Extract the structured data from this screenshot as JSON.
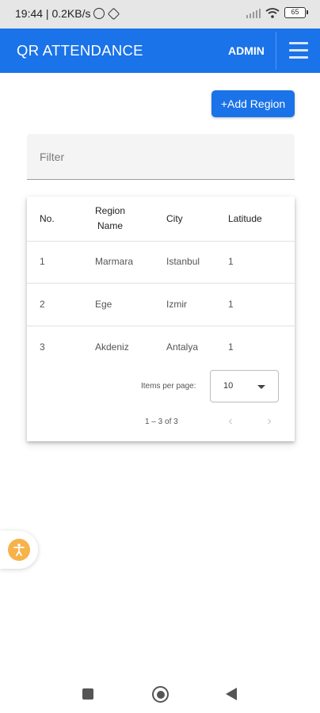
{
  "status_bar": {
    "time_speed": "19:44 | 0.2KB/s",
    "battery": "65"
  },
  "app_bar": {
    "title": "QR ATTENDANCE",
    "admin_label": "ADMIN",
    "menu_icon": "hamburger-menu-icon",
    "color": "#1a73e8"
  },
  "add_button": {
    "label": "+Add Region"
  },
  "filter": {
    "placeholder": "Filter",
    "value": ""
  },
  "table": {
    "headers": {
      "no": "No.",
      "region_line1": "Region",
      "region_line2": "Name",
      "city": "City",
      "latitude": "Latitude"
    },
    "rows": [
      {
        "no": "1",
        "region": "Marmara",
        "city": "Istanbul",
        "latitude": "1"
      },
      {
        "no": "2",
        "region": "Ege",
        "city": "Izmir",
        "latitude": "1"
      },
      {
        "no": "3",
        "region": "Akdeniz",
        "city": "Antalya",
        "latitude": "1"
      }
    ]
  },
  "paginator": {
    "items_per_page_label": "Items per page:",
    "page_size": "10",
    "range_label": "1 – 3 of 3",
    "prev_icon": "chevron-left-icon",
    "next_icon": "chevron-right-icon"
  },
  "accessibility": {
    "icon": "accessibility-icon",
    "color": "#f7b24a"
  }
}
